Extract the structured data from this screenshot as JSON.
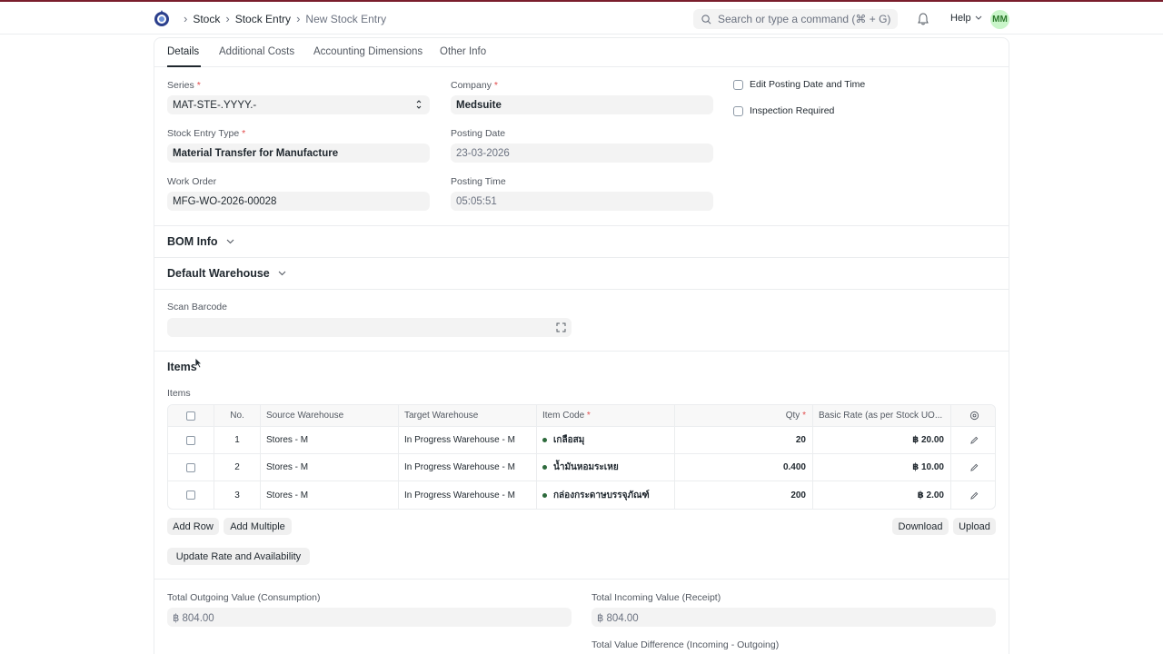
{
  "navbar": {
    "breadcrumbs": [
      "Stock",
      "Stock Entry",
      "New Stock Entry"
    ],
    "search_placeholder": "Search or type a command (⌘ + G)",
    "help_label": "Help",
    "avatar_initials": "MM"
  },
  "tabs": [
    "Details",
    "Additional Costs",
    "Accounting Dimensions",
    "Other Info"
  ],
  "form": {
    "series_label": "Series",
    "series_value": "MAT-STE-.YYYY.-",
    "company_label": "Company",
    "company_value": "Medsuite",
    "edit_posting_label": "Edit Posting Date and Time",
    "inspection_label": "Inspection Required",
    "entry_type_label": "Stock Entry Type",
    "entry_type_value": "Material Transfer for Manufacture",
    "posting_date_label": "Posting Date",
    "posting_date_value": "23-03-2026",
    "work_order_label": "Work Order",
    "work_order_value": "MFG-WO-2026-00028",
    "posting_time_label": "Posting Time",
    "posting_time_value": "05:05:51",
    "required_mark": "*"
  },
  "sections": {
    "bom_info": "BOM Info",
    "default_warehouse": "Default Warehouse",
    "scan_barcode_label": "Scan Barcode",
    "items_title": "Items",
    "items_table_label": "Items"
  },
  "items_table": {
    "columns": {
      "no": "No.",
      "source": "Source Warehouse",
      "target": "Target Warehouse",
      "item_code": "Item Code",
      "qty": "Qty",
      "rate": "Basic Rate (as per Stock UO..."
    },
    "rows": [
      {
        "no": "1",
        "source": "Stores - M",
        "target": "In Progress Warehouse - M",
        "item_code": "เกลือสมุ",
        "qty": "20",
        "rate": "฿ 20.00"
      },
      {
        "no": "2",
        "source": "Stores - M",
        "target": "In Progress Warehouse - M",
        "item_code": "น้ำมันหอมระเหย",
        "qty": "0.400",
        "rate": "฿ 10.00"
      },
      {
        "no": "3",
        "source": "Stores - M",
        "target": "In Progress Warehouse - M",
        "item_code": "กล่องกระดาษบรรจุภัณฑ์",
        "qty": "200",
        "rate": "฿ 2.00"
      }
    ]
  },
  "buttons": {
    "add_row": "Add Row",
    "add_multiple": "Add Multiple",
    "download": "Download",
    "upload": "Upload",
    "update_rate": "Update Rate and Availability"
  },
  "totals": {
    "outgoing_label": "Total Outgoing Value (Consumption)",
    "outgoing_value": "฿ 804.00",
    "incoming_label": "Total Incoming Value (Receipt)",
    "incoming_value": "฿ 804.00",
    "difference_label": "Total Value Difference (Incoming - Outgoing)"
  },
  "colors": {
    "accent_top_border": "#7a1e2c",
    "avatar_bg": "#c9f5c9",
    "item_dot": "#2d6a3c",
    "required": "#e24c4c"
  }
}
